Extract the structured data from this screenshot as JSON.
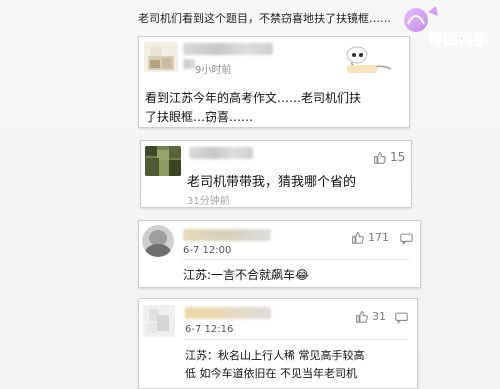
{
  "headline": "老司机们看到这个题目，不禁窃喜地扶了扶镜框……",
  "watermark": {
    "text": "神回科学"
  },
  "comments": [
    {
      "time": "9小时前",
      "text_lines": [
        "看到江苏今年的高考作文……老司机们扶",
        "了扶眼框…窃喜……"
      ]
    },
    {
      "time": "31分钟前",
      "likes": "15",
      "text": "老司机带带我，猜我哪个省的"
    },
    {
      "time": "6-7 12:00",
      "likes": "171",
      "text": "江苏:一言不合就飙车",
      "emoji": "😂"
    },
    {
      "time": "6-7 12:16",
      "likes": "31",
      "text_lines": [
        "江苏：秋名山上行人稀 常见高手较高",
        "低 如今车道依旧在 不见当年老司机"
      ]
    }
  ],
  "colors": {
    "card_bg": "#ffffff",
    "card_border": "#cfcfcf",
    "meta_text": "#8e8e8e",
    "page_bg": "#f4f4f4"
  },
  "icons": [
    "thumbs-up-icon",
    "reply-icon",
    "cartoon-avatar-icon",
    "watermark-logo"
  ]
}
